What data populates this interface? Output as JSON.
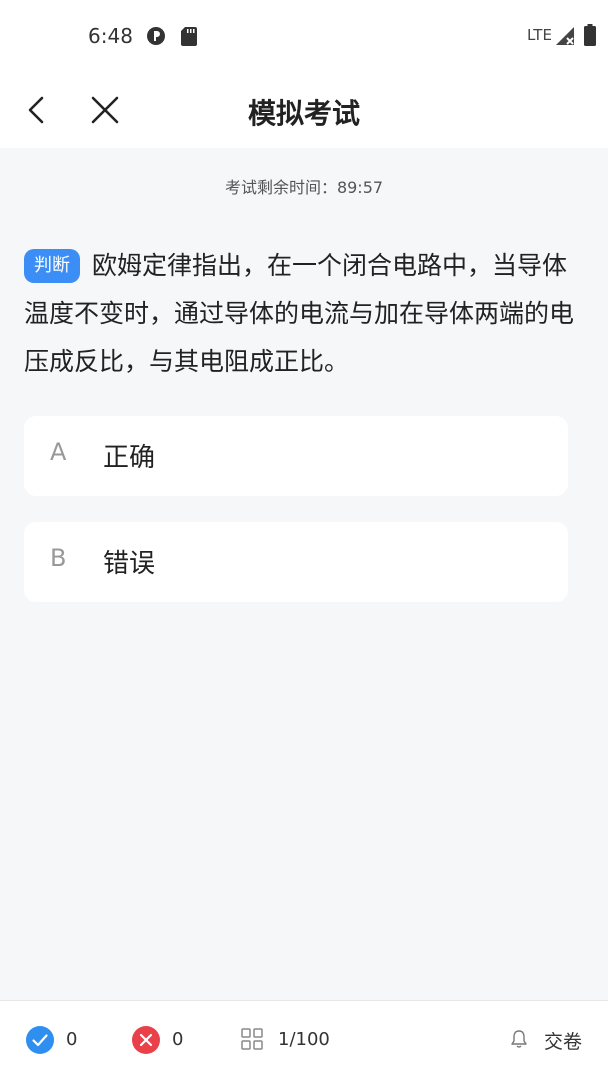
{
  "status_bar": {
    "time": "6:48",
    "network": "LTE"
  },
  "nav": {
    "title": "模拟考试",
    "back_icon": "chevron-left-icon",
    "close_icon": "close-icon"
  },
  "timer": {
    "label": "考试剩余时间：89:57"
  },
  "question": {
    "tag": "判断",
    "text": "欧姆定律指出，在一个闭合电路中，当导体温度不变时，通过导体的电流与加在导体两端的电压成反比，与其电阻成正比。"
  },
  "options": [
    {
      "letter": "A",
      "text": "正确"
    },
    {
      "letter": "B",
      "text": "错误"
    }
  ],
  "bottom": {
    "correct_count": "0",
    "wrong_count": "0",
    "progress": "1/100",
    "submit_label": "交卷"
  },
  "colors": {
    "accent": "#3b8ef5",
    "correct": "#2f8ff0",
    "wrong": "#e9404a",
    "background": "#f6f7f9"
  }
}
